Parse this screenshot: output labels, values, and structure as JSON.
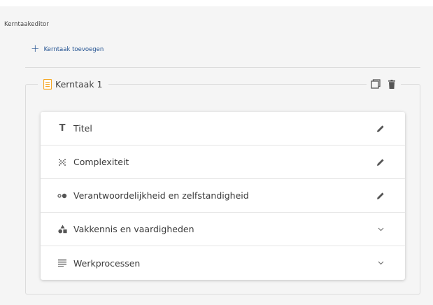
{
  "editor": {
    "label": "Kerntaakeditor",
    "add_label": "Kerntaak toevoegen"
  },
  "kerntaak": {
    "title": "Kerntaak 1",
    "rows": [
      {
        "label": "Titel",
        "icon": "text-icon",
        "action": "edit-icon"
      },
      {
        "label": "Complexiteit",
        "icon": "complexity-icon",
        "action": "edit-icon"
      },
      {
        "label": "Verantwoordelijkheid en zelfstandigheid",
        "icon": "responsibility-icon",
        "action": "edit-icon"
      },
      {
        "label": "Vakkennis en vaardigheden",
        "icon": "shapes-icon",
        "action": "chevron-down-icon"
      },
      {
        "label": "Werkprocessen",
        "icon": "list-icon",
        "action": "chevron-down-icon"
      }
    ]
  },
  "colors": {
    "accent_link": "#1f4f8f",
    "doc_icon": "#f5a623",
    "panel_bg": "#f5f5f5"
  }
}
